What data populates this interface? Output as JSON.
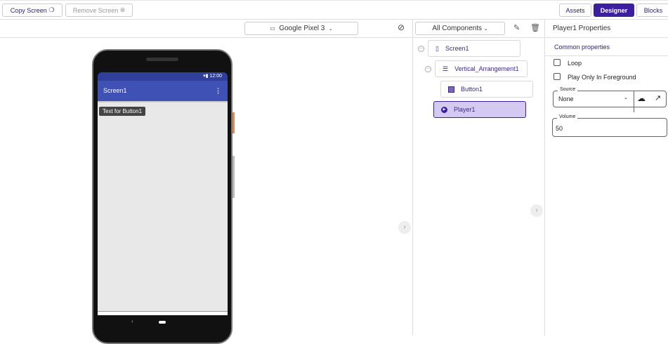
{
  "toolbar": {
    "copy_screen": "Copy Screen",
    "remove_screen": "Remove Screen",
    "assets": "Assets",
    "designer": "Designer",
    "blocks": "Blocks"
  },
  "viewer": {
    "device": "Google Pixel 3",
    "phone": {
      "time": "12:00",
      "title": "Screen1",
      "button_text": "Text for Button1"
    }
  },
  "components": {
    "filter": "All Components",
    "tree": [
      {
        "label": "Screen1"
      },
      {
        "label": "Vertical_Arrangement1"
      },
      {
        "label": "Button1"
      },
      {
        "label": "Player1"
      }
    ]
  },
  "properties": {
    "title": "Player1 Properties",
    "section": "Common properties",
    "loop": "Loop",
    "play_foreground": "Play Only In Foreground",
    "source_label": "Source",
    "source_value": "None",
    "volume_label": "Volume",
    "volume_value": "50"
  },
  "colors": {
    "accent": "#3b1f9e",
    "appbar": "#3f51b5",
    "selected": "#d4c9f0"
  }
}
